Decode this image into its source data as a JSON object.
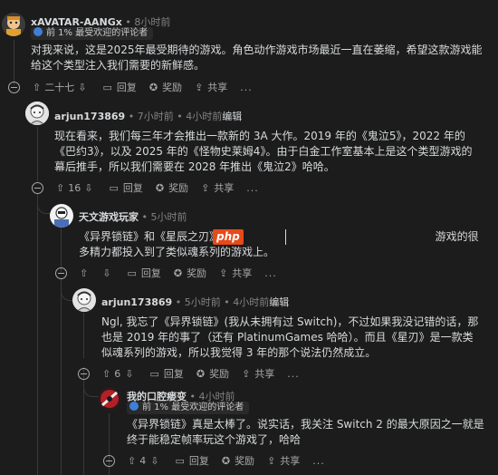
{
  "comments": [
    {
      "user": "xAVATAR-AANGx",
      "time": "8小时前",
      "flair": "前 1% 最受欢迎的评论者",
      "text": "对我来说，这是2025年最受期待的游戏。角色动作游戏市场最近一直在萎缩，希望这款游戏能给这个类型注入我们需要的新鲜感。",
      "score": "二十七",
      "reply": "回复",
      "award": "奖励",
      "share": "共享",
      "more": "..."
    },
    {
      "user": "arjun173869",
      "time": "7小时前",
      "edit_time": "4小时前",
      "edited": "编辑",
      "text": "现在看来，我们每三年才会推出一款新的 3A 大作。2019 年的《鬼泣5》，2022 年的《巴约3》，以及 2025 年的《怪物史莱姆4》。由于白金工作室基本上是这个类型游戏的幕后推手，所以我们需要在 2028 年推出《鬼泣2》哈哈。",
      "score": "16",
      "reply": "回复",
      "award": "奖励",
      "share": "共享",
      "more": "..."
    },
    {
      "user": "天文游戏玩家",
      "time": "5小时前",
      "text_before": "《异界锁链》和《星辰之刃》",
      "text_after": "游戏的很多精力都投入到了类似魂系列的游戏上。",
      "watermark": "php",
      "score": "",
      "reply": "回复",
      "award": "奖励",
      "share": "共享",
      "more": "..."
    },
    {
      "user": "arjun173869",
      "time": "5小时前",
      "edit_time": "4小时前",
      "edited": "编辑",
      "text": "Ngl, 我忘了《异界锁链》(我从未拥有过 Switch)，不过如果我没记错的话，那也是 2019 年的事了（还有 PlatinumGames 哈哈）。而且《星刃》是一款类似魂系列的游戏，所以我觉得 3 年的那个说法仍然成立。",
      "score": "6",
      "reply": "回复",
      "award": "奖励",
      "share": "共享",
      "more": "..."
    },
    {
      "user": "我的口腔瘘变",
      "time": "4小时前",
      "flair": "前 1% 最受欢迎的评论者",
      "text": "《异界锁链》真是太棒了。说实话，我关注 Switch 2 的最大原因之一就是终于能稳定帧率玩这个游戏了，哈哈",
      "score": "4",
      "reply": "回复",
      "award": "奖励",
      "share": "共享",
      "more": "..."
    }
  ]
}
